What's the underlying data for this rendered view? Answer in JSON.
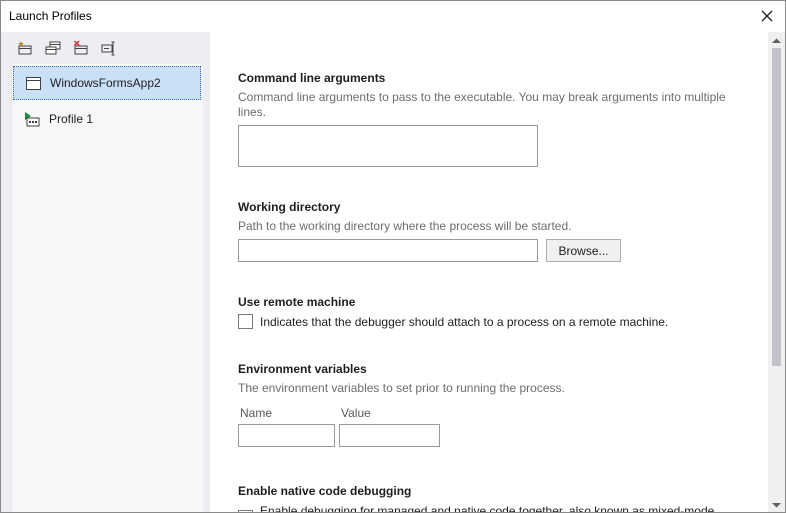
{
  "window": {
    "title": "Launch Profiles"
  },
  "toolbar": {
    "buttons": [
      {
        "icon": "new-profile-icon"
      },
      {
        "icon": "duplicate-profile-icon"
      },
      {
        "icon": "delete-profile-icon"
      },
      {
        "icon": "rename-profile-icon"
      }
    ]
  },
  "profiles": [
    {
      "label": "WindowsFormsApp2",
      "icon": "window-icon",
      "selected": true
    },
    {
      "label": "Profile 1",
      "icon": "executable-profile-icon",
      "selected": false
    }
  ],
  "sections": {
    "command_line": {
      "title": "Command line arguments",
      "desc_line1": "Command line arguments to pass to the executable. You may break arguments into multiple",
      "desc_line2": "lines.",
      "value": ""
    },
    "working_dir": {
      "title": "Working directory",
      "desc": "Path to the working directory where the process will be started.",
      "value": "",
      "browse_label": "Browse..."
    },
    "remote": {
      "title": "Use remote machine",
      "check_label": "Indicates that the debugger should attach to a process on a remote machine.",
      "checked": false
    },
    "env": {
      "title": "Environment variables",
      "desc": "The environment variables to set prior to running the process.",
      "name_col": "Name",
      "value_col": "Value",
      "name_value": "",
      "value_value": ""
    },
    "native": {
      "title": "Enable native code debugging",
      "check_label": "Enable debugging for managed and native code together, also known as mixed-mode",
      "checked": false
    }
  },
  "colors": {
    "selection": "#c9e0f7",
    "left_panel": "#eeeef2",
    "scroll_thumb": "#c2c3c9"
  }
}
